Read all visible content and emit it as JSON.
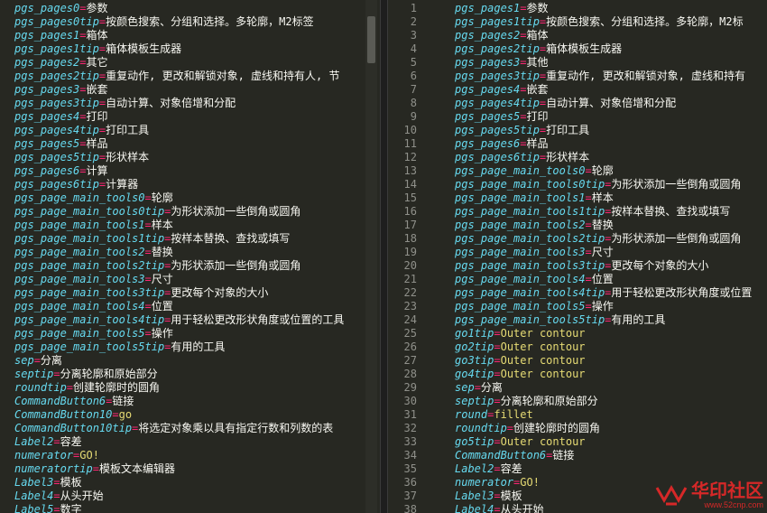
{
  "left": {
    "lines": [
      {
        "key": "pgs_pages0",
        "value": "参数"
      },
      {
        "key": "pgs_pages0tip",
        "value": "按颜色搜索、分组和选择。多轮廓，M2标签"
      },
      {
        "key": "pgs_pages1",
        "value": "箱体"
      },
      {
        "key": "pgs_pages1tip",
        "value": "箱体模板生成器"
      },
      {
        "key": "pgs_pages2",
        "value": "其它"
      },
      {
        "key": "pgs_pages2tip",
        "value": "重复动作, 更改和解锁对象, 虚线和持有人, 节"
      },
      {
        "key": "pgs_pages3",
        "value": "嵌套"
      },
      {
        "key": "pgs_pages3tip",
        "value": "自动计算、对象倍增和分配"
      },
      {
        "key": "pgs_pages4",
        "value": "打印"
      },
      {
        "key": "pgs_pages4tip",
        "value": "打印工具"
      },
      {
        "key": "pgs_pages5",
        "value": "样品"
      },
      {
        "key": "pgs_pages5tip",
        "value": "形状样本"
      },
      {
        "key": "pgs_pages6",
        "value": "计算"
      },
      {
        "key": "pgs_pages6tip",
        "value": "计算器"
      },
      {
        "key": "pgs_page_main_tools0",
        "value": "轮廓"
      },
      {
        "key": "pgs_page_main_tools0tip",
        "value": "为形状添加一些倒角或圆角"
      },
      {
        "key": "pgs_page_main_tools1",
        "value": "样本"
      },
      {
        "key": "pgs_page_main_tools1tip",
        "value": "按样本替换、查找或填写"
      },
      {
        "key": "pgs_page_main_tools2",
        "value": "替换"
      },
      {
        "key": "pgs_page_main_tools2tip",
        "value": "为形状添加一些倒角或圆角"
      },
      {
        "key": "pgs_page_main_tools3",
        "value": "尺寸"
      },
      {
        "key": "pgs_page_main_tools3tip",
        "value": "更改每个对象的大小"
      },
      {
        "key": "pgs_page_main_tools4",
        "value": "位置"
      },
      {
        "key": "pgs_page_main_tools4tip",
        "value": "用于轻松更改形状角度或位置的工具"
      },
      {
        "key": "pgs_page_main_tools5",
        "value": "操作"
      },
      {
        "key": "pgs_page_main_tools5tip",
        "value": "有用的工具"
      },
      {
        "key": "sep",
        "value": "分离"
      },
      {
        "key": "septip",
        "value": "分离轮廓和原始部分"
      },
      {
        "key": "roundtip",
        "value": "创建轮廓时的圆角"
      },
      {
        "key": "CommandButton6",
        "value": "链接"
      },
      {
        "key": "CommandButton10",
        "value": "go"
      },
      {
        "key": "CommandButton10tip",
        "value": "将选定对象乘以具有指定行数和列数的表"
      },
      {
        "key": "Label2",
        "value": "容差"
      },
      {
        "key": "numerator",
        "value": "GO!"
      },
      {
        "key": "numeratortip",
        "value": "模板文本编辑器"
      },
      {
        "key": "Label3",
        "value": "模板"
      },
      {
        "key": "Label4",
        "value": "从头开始"
      },
      {
        "key": "Label5",
        "value": "数字"
      }
    ]
  },
  "right": {
    "lines": [
      {
        "n": "1",
        "key": "pgs_pages1",
        "value": "参数"
      },
      {
        "n": "2",
        "key": "pgs_pages1tip",
        "value": "按颜色搜索、分组和选择。多轮廓，M2标"
      },
      {
        "n": "3",
        "key": "pgs_pages2",
        "value": "箱体"
      },
      {
        "n": "4",
        "key": "pgs_pages2tip",
        "value": "箱体模板生成器"
      },
      {
        "n": "5",
        "key": "pgs_pages3",
        "value": "其他"
      },
      {
        "n": "6",
        "key": "pgs_pages3tip",
        "value": "重复动作, 更改和解锁对象, 虚线和持有"
      },
      {
        "n": "7",
        "key": "pgs_pages4",
        "value": "嵌套"
      },
      {
        "n": "8",
        "key": "pgs_pages4tip",
        "value": "自动计算、对象倍增和分配"
      },
      {
        "n": "9",
        "key": "pgs_pages5",
        "value": "打印"
      },
      {
        "n": "10",
        "key": "pgs_pages5tip",
        "value": "打印工具"
      },
      {
        "n": "11",
        "key": "pgs_pages6",
        "value": "样品"
      },
      {
        "n": "12",
        "key": "pgs_pages6tip",
        "value": "形状样本"
      },
      {
        "n": "13",
        "key": "pgs_page_main_tools0",
        "value": "轮廓"
      },
      {
        "n": "14",
        "key": "pgs_page_main_tools0tip",
        "value": "为形状添加一些倒角或圆角"
      },
      {
        "n": "15",
        "key": "pgs_page_main_tools1",
        "value": "样本"
      },
      {
        "n": "16",
        "key": "pgs_page_main_tools1tip",
        "value": "按样本替换、查找或填写"
      },
      {
        "n": "17",
        "key": "pgs_page_main_tools2",
        "value": "替换"
      },
      {
        "n": "18",
        "key": "pgs_page_main_tools2tip",
        "value": "为形状添加一些倒角或圆角"
      },
      {
        "n": "19",
        "key": "pgs_page_main_tools3",
        "value": "尺寸"
      },
      {
        "n": "20",
        "key": "pgs_page_main_tools3tip",
        "value": "更改每个对象的大小"
      },
      {
        "n": "21",
        "key": "pgs_page_main_tools4",
        "value": "位置"
      },
      {
        "n": "22",
        "key": "pgs_page_main_tools4tip",
        "value": "用于轻松更改形状角度或位置"
      },
      {
        "n": "23",
        "key": "pgs_page_main_tools5",
        "value": "操作"
      },
      {
        "n": "24",
        "key": "pgs_page_main_tools5tip",
        "value": "有用的工具"
      },
      {
        "n": "25",
        "key": "go1tip",
        "value": "Outer contour"
      },
      {
        "n": "26",
        "key": "go2tip",
        "value": "Outer contour"
      },
      {
        "n": "27",
        "key": "go3tip",
        "value": "Outer contour"
      },
      {
        "n": "28",
        "key": "go4tip",
        "value": "Outer contour"
      },
      {
        "n": "29",
        "key": "sep",
        "value": "分离"
      },
      {
        "n": "30",
        "key": "septip",
        "value": "分离轮廓和原始部分"
      },
      {
        "n": "31",
        "key": "round",
        "value": "fillet"
      },
      {
        "n": "32",
        "key": "roundtip",
        "value": "创建轮廓时的圆角"
      },
      {
        "n": "33",
        "key": "go5tip",
        "value": "Outer contour"
      },
      {
        "n": "34",
        "key": "CommandButton6",
        "value": "链接"
      },
      {
        "n": "35",
        "key": "Label2",
        "value": "容差"
      },
      {
        "n": "36",
        "key": "numerator",
        "value": "GO!"
      },
      {
        "n": "37",
        "key": "Label3",
        "value": "模板"
      },
      {
        "n": "38",
        "key": "Label4",
        "value": "从头开始"
      }
    ]
  },
  "watermark": {
    "text": "华印社区",
    "url": "www.52cnp.com"
  },
  "colors": {
    "background": "#272822",
    "key": "#66d9ef",
    "equals": "#f92672",
    "value_ascii": "#e6db74",
    "value_cjk": "#f8f8f2",
    "line_number": "#8f908a"
  }
}
